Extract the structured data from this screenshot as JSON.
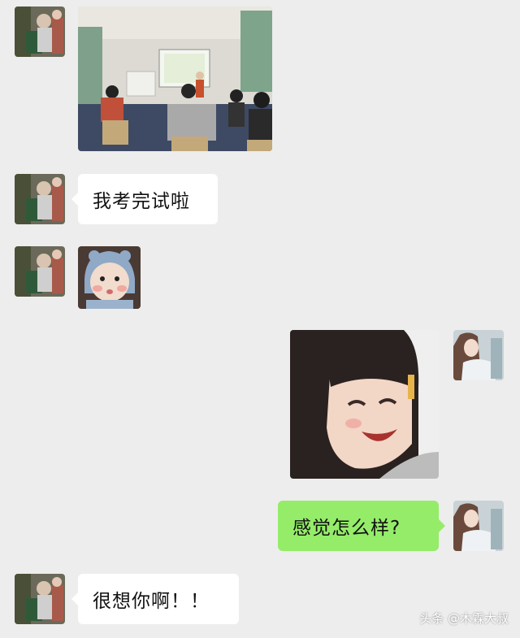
{
  "messages": [
    {
      "sender": "other",
      "type": "image",
      "image_name": "classroom-photo"
    },
    {
      "sender": "other",
      "type": "text",
      "text": "我考完试啦"
    },
    {
      "sender": "other",
      "type": "image",
      "image_name": "baby-sticker"
    },
    {
      "sender": "self",
      "type": "image",
      "image_name": "laughing-girl-sticker"
    },
    {
      "sender": "self",
      "type": "text",
      "text": "感觉怎么样?"
    },
    {
      "sender": "other",
      "type": "text",
      "text": "很想你啊！！"
    }
  ],
  "watermark": "头条 @木霖大叔",
  "colors": {
    "background": "#ededed",
    "self_bubble": "#95ec69",
    "other_bubble": "#ffffff"
  }
}
